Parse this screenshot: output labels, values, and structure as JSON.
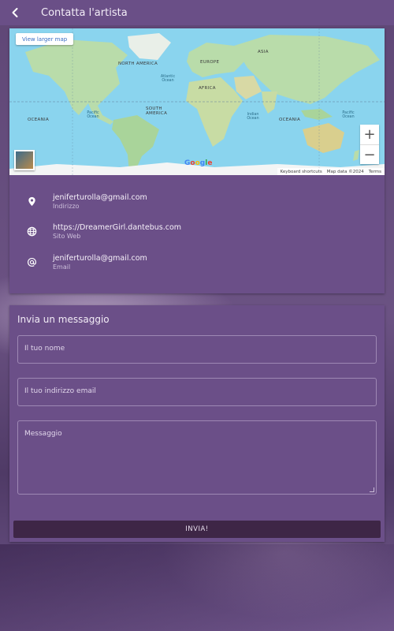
{
  "header": {
    "title": "Contatta l'artista",
    "back_icon": "chevron-left-icon"
  },
  "map": {
    "view_larger": "View larger map",
    "zoom_in": "+",
    "zoom_out": "−",
    "logo": "Google",
    "footer": [
      "Keyboard shortcuts",
      "Map data ©2024",
      "Terms"
    ],
    "continents": [
      "NORTH AMERICA",
      "EUROPE",
      "ASIA",
      "AFRICA",
      "SOUTH AMERICA",
      "OCEANIA",
      "OCEANIA"
    ],
    "oceans": [
      "Atlantic Ocean",
      "Pacific Ocean",
      "Indian Ocean",
      "Pacific Ocean",
      "Pacific Ocean",
      "Pacific Ocean"
    ],
    "water_color": "#8ad4ee",
    "land_color": "#b9dcaa"
  },
  "contact": {
    "items": [
      {
        "icon": "location-pin-icon",
        "primary": "jeniferturolla@gmail.com",
        "secondary": "Indirizzo"
      },
      {
        "icon": "globe-icon",
        "primary": "https://DreamerGirl.dantebus.com",
        "secondary": "Sito Web"
      },
      {
        "icon": "at-sign-icon",
        "primary": "jeniferturolla@gmail.com",
        "secondary": "Email"
      }
    ]
  },
  "form": {
    "title": "Invia un messaggio",
    "name_placeholder": "Il tuo nome",
    "email_placeholder": "Il tuo indirizzo email",
    "message_placeholder": "Messaggio",
    "send_label": "INVIA!"
  },
  "colors": {
    "card": "#6b4f88",
    "topbar": "#6a4f87",
    "button": "#3e2646"
  }
}
